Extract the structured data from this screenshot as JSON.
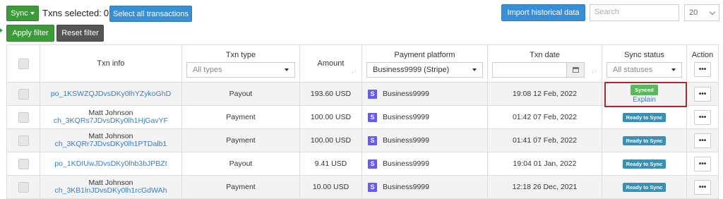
{
  "toolbar": {
    "sync_label": "Sync",
    "selected_label": "Txns selected:",
    "selected_count": "0",
    "select_all_label": "Select all transactions",
    "import_label": "Import historical data",
    "search_placeholder": "Search",
    "page_size": "20"
  },
  "filters": {
    "apply_label": "Apply filter",
    "reset_label": "Reset filter"
  },
  "columns": {
    "txn_info": "Txn info",
    "txn_type": "Txn type",
    "amount": "Amount",
    "payment_platform": "Payment platform",
    "txn_date": "Txn date",
    "sync_status": "Sync status",
    "action": "Action"
  },
  "column_filters": {
    "txn_type": "All types",
    "payment_platform": "Business9999 (Stripe)",
    "sync_status": "All statuses"
  },
  "rows": [
    {
      "name": "",
      "id": "po_1KSWZQJDvsDKy0lhYZykoGhD",
      "type": "Payout",
      "amount": "193.60 USD",
      "platform": "Business9999",
      "date": "19:08 12 Feb, 2022",
      "status": "Synced",
      "explain": "Explain"
    },
    {
      "name": "Matt Johnson",
      "id": "ch_3KQRs7JDvsDKy0lh1HjGavYF",
      "type": "Payment",
      "amount": "100.00 USD",
      "platform": "Business9999",
      "date": "01:42 07 Feb, 2022",
      "status": "Ready to Sync"
    },
    {
      "name": "Matt Johnson",
      "id": "ch_3KQRr7JDvsDKy0lh1PTDalb1",
      "type": "Payment",
      "amount": "100.00 USD",
      "platform": "Business9999",
      "date": "01:41 07 Feb, 2022",
      "status": "Ready to Sync"
    },
    {
      "name": "",
      "id": "po_1KDIUwJDvsDKy0lhb3bJPBZt",
      "type": "Payout",
      "amount": "9.41 USD",
      "platform": "Business9999",
      "date": "19:04 01 Jan, 2022",
      "status": "Ready to Sync"
    },
    {
      "name": "Matt Johnson",
      "id": "ch_3KB1lnJDvsDKy0lh1rcGdWAh",
      "type": "Payment",
      "amount": "10.00 USD",
      "platform": "Business9999",
      "date": "12:18 26 Dec, 2021",
      "status": "Ready to Sync"
    }
  ],
  "action_glyph": "•••",
  "platform_icon_letter": "S",
  "colors": {
    "green": "#3c9a3a",
    "blue": "#3a8ed3",
    "ready_badge": "#3a8fb7",
    "synced_badge": "#5cb85c",
    "highlight": "#a0302d",
    "stripe": "#635bff"
  }
}
